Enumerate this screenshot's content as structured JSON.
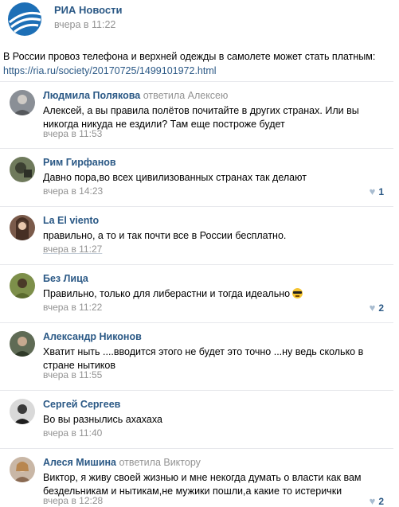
{
  "post": {
    "author": "РИА Новости",
    "date": "вчера в 11:22",
    "text": "В России провоз телефона и верхней одежды в самолете может стать платным:",
    "link": "https://ria.ru/society/20170725/1499101972.html"
  },
  "colors": {
    "link": "#2a5885",
    "meta": "#939393",
    "logo_blue": "#1d6fb6"
  },
  "comments": [
    {
      "name": "Людмила Полякова",
      "reply": "ответила Алексею",
      "text": "Алексей, а вы правила полётов почитайте в других странах. Или вы никогда никуда не ездили? Там еще построже будет",
      "date": "вчера в 11:53",
      "likes": ""
    },
    {
      "name": "Рим Гирфанов",
      "reply": "",
      "text": "Давно пора,во всех цивилизованных странах так делают",
      "date": "вчера в 14:23",
      "likes": "1"
    },
    {
      "name": "La El viento",
      "reply": "",
      "text": "правильно, а то и так почти все в России бесплатно.",
      "date": "вчера в 11:27",
      "likes": ""
    },
    {
      "name": "Без Лица",
      "reply": "",
      "text": "Правильно, только для либерастни и тогда идеально",
      "date": "вчера в 11:22",
      "likes": "2"
    },
    {
      "name": "Александр Никонов",
      "reply": "",
      "text": "Хватит ныть ....вводится этого не будет это точно ...ну ведь сколько в стране нытиков",
      "date": "вчера в 11:55",
      "likes": ""
    },
    {
      "name": "Сергей Сергеев",
      "reply": "",
      "text": "Во вы разнылись ахахаха",
      "date": "вчера в 11:40",
      "likes": ""
    },
    {
      "name": "Алеся Мишина",
      "reply": "ответила Виктору",
      "text": "Виктор, я живу своей жизнью и мне некогда думать о власти как вам бездельникам и нытикам,не мужики пошли,а какие то истерички",
      "date": "вчера в 12:28",
      "likes": "2"
    }
  ]
}
